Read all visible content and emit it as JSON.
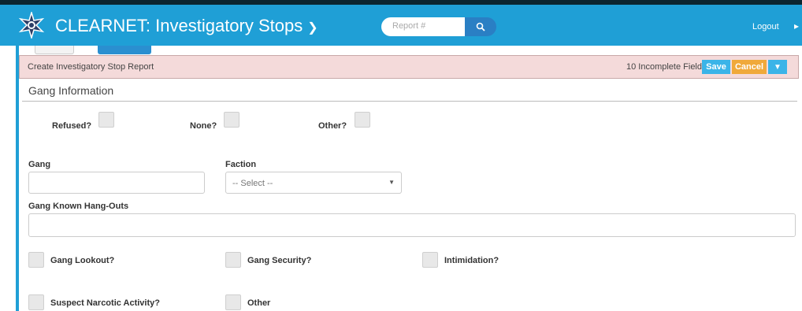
{
  "header": {
    "app_title": "CLEARNET: Investigatory Stops",
    "logo_icon": "police-star-badge-icon",
    "search_placeholder": "Report #",
    "search_icon": "search-icon",
    "logout_label": "Logout",
    "brand_color": "#1f9fd6"
  },
  "report_bar": {
    "title": "Create Investigatory Stop Report",
    "incomplete_text": "10 Incomplete Fields",
    "save_label": "Save",
    "cancel_label": "Cancel",
    "dropdown_icon": "caret-down-icon",
    "background_color": "#f4dada"
  },
  "section": {
    "title": "Gang Information"
  },
  "checks_top": {
    "refused_label": "Refused?",
    "none_label": "None?",
    "other_label": "Other?"
  },
  "fields": {
    "gang_label": "Gang",
    "gang_value": "",
    "faction_label": "Faction",
    "faction_value": "-- Select --",
    "hangouts_label": "Gang Known Hang-Outs",
    "hangouts_value": ""
  },
  "checks_bottom": {
    "lookout_label": "Gang Lookout?",
    "security_label": "Gang Security?",
    "intimidation_label": "Intimidation?",
    "narcotic_label": "Suspect Narcotic Activity?",
    "other_label": "Other"
  }
}
